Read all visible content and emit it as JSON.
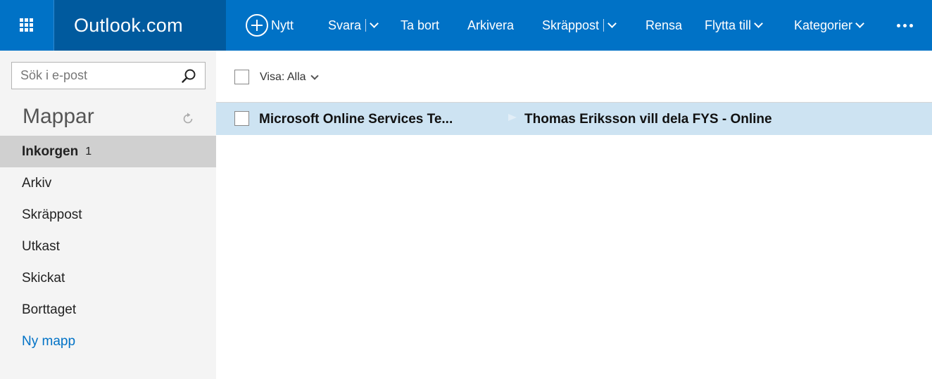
{
  "app": {
    "brand": "Outlook.com"
  },
  "toolbar": {
    "new_label": "Nytt",
    "reply_label": "Svara",
    "delete_label": "Ta bort",
    "archive_label": "Arkivera",
    "junk_label": "Skräppost",
    "sweep_label": "Rensa",
    "move_label": "Flytta till",
    "categories_label": "Kategorier",
    "more_icon": "more-dots-icon"
  },
  "sidebar": {
    "search_placeholder": "Sök i e-post",
    "folders_title": "Mappar",
    "folders": [
      {
        "label": "Inkorgen",
        "count": "1",
        "selected": true
      },
      {
        "label": "Arkiv"
      },
      {
        "label": "Skräppost"
      },
      {
        "label": "Utkast"
      },
      {
        "label": "Skickat"
      },
      {
        "label": "Borttaget"
      }
    ],
    "new_folder": "Ny mapp"
  },
  "main": {
    "filter": {
      "label": "Visa: Alla"
    },
    "messages": [
      {
        "sender": "Microsoft Online Services Te...",
        "subject": "Thomas Eriksson vill dela FYS - Online",
        "unread": true
      }
    ]
  },
  "colors": {
    "topbar": "#0072c6",
    "brand_bg": "#005a9e",
    "sidebar_bg": "#f4f4f4",
    "selected_folder": "#d0d0d0",
    "selected_row": "#cde3f2",
    "link": "#0072c6"
  }
}
